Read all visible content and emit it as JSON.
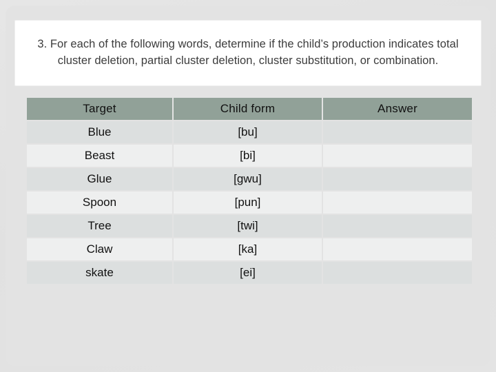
{
  "slide": {
    "prompt": "3. For each of the following words, determine if the child’s production indicates total cluster deletion, partial cluster deletion, cluster substitution, or combination."
  },
  "table": {
    "headers": {
      "target": "Target",
      "child_form": "Child form",
      "answer": "Answer"
    },
    "rows": [
      {
        "target": "Blue",
        "child_form": "[bu]",
        "answer": ""
      },
      {
        "target": "Beast",
        "child_form": "[bi]",
        "answer": ""
      },
      {
        "target": "Glue",
        "child_form": "[gwu]",
        "answer": ""
      },
      {
        "target": "Spoon",
        "child_form": "[pun]",
        "answer": ""
      },
      {
        "target": "Tree",
        "child_form": "[twi]",
        "answer": ""
      },
      {
        "target": "Claw",
        "child_form": "[ka]",
        "answer": ""
      },
      {
        "target": "skate",
        "child_form": "[ei]",
        "answer": ""
      }
    ]
  },
  "colors": {
    "header_fill": "#91a198",
    "header_text": "#ffffff",
    "row_odd_fill": "#dcdfdf",
    "row_even_fill": "#eeefef",
    "page_background": "#e3e3e3",
    "card_background": "#ffffff",
    "body_text": "#111111",
    "prompt_text": "#3c3c3c"
  }
}
